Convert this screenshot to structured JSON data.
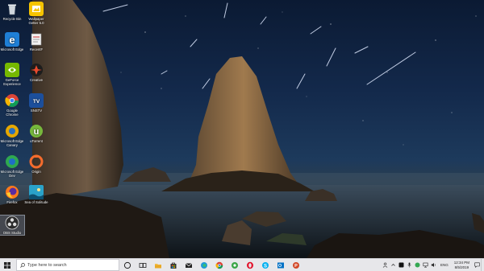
{
  "desktop": {
    "icons": [
      {
        "label": "Recycle Bin",
        "icon": "recycle-bin-icon"
      },
      {
        "label": "Wallpaper Getter 5.0",
        "icon": "wallpaper-app-icon"
      },
      {
        "label": "Microsoft Edge",
        "icon": "edge-icon"
      },
      {
        "label": "RecentF",
        "icon": "recent-files-icon"
      },
      {
        "label": "GeForce Experience",
        "icon": "geforce-icon"
      },
      {
        "label": "Creative",
        "icon": "creative-icon"
      },
      {
        "label": "Google Chrome",
        "icon": "chrome-icon"
      },
      {
        "label": "SNSTV",
        "icon": "snstv-icon"
      },
      {
        "label": "Microsoft Edge Canary",
        "icon": "edge-canary-icon"
      },
      {
        "label": "uTorrent",
        "icon": "utorrent-icon"
      },
      {
        "label": "Microsoft Edge Dev",
        "icon": "edge-dev-icon"
      },
      {
        "label": "Origin",
        "icon": "origin-icon"
      },
      {
        "label": "Firefox",
        "icon": "firefox-icon"
      },
      {
        "label": "Sea of Solitude",
        "icon": "sea-of-solitude-icon"
      },
      {
        "label": "OBS Studio",
        "icon": "obs-icon"
      }
    ]
  },
  "taskbar": {
    "search_placeholder": "Type here to search",
    "pinned_apps": [
      "cortana-icon",
      "task-view-icon",
      "file-explorer-icon",
      "store-icon",
      "mail-icon",
      "edge-icon",
      "chrome-icon",
      "app-green-icon",
      "opera-icon",
      "skype-icon",
      "outlook-icon",
      "powerpoint-icon"
    ],
    "tray": {
      "language": "ENG",
      "time": "12:34 PM",
      "date": "8/5/2019"
    }
  },
  "colors": {
    "taskbar_bg": "#e7e7ea",
    "sky_top": "#0b1a33"
  }
}
